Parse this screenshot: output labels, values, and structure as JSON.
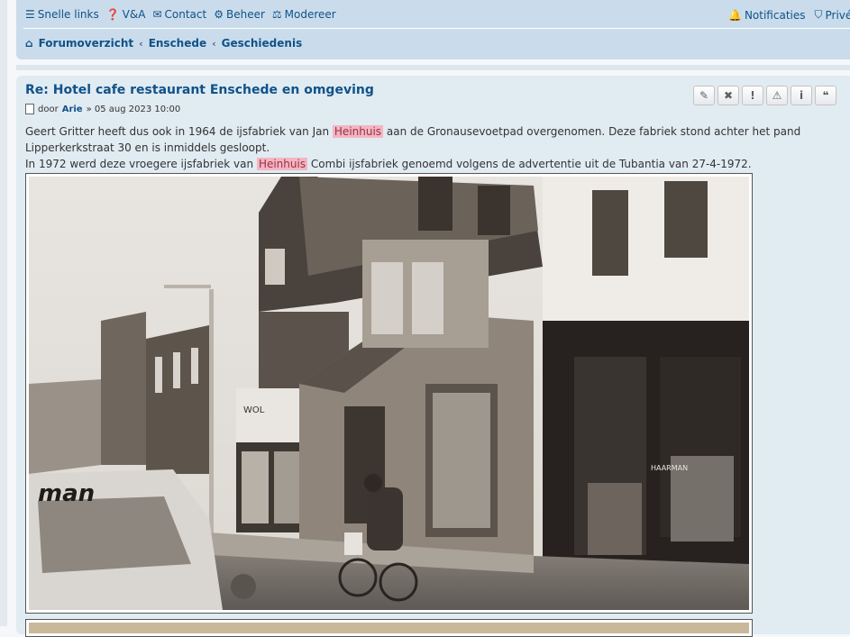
{
  "nav": {
    "quick_links": "Snelle links",
    "faq": "V&A",
    "contact": "Contact",
    "admin": "Beheer",
    "moderate": "Modereer",
    "notifications": "Notificaties",
    "private": "Privéb"
  },
  "breadcrumbs": [
    "Forumoverzicht",
    "Enschede",
    "Geschiedenis"
  ],
  "post": {
    "title": "Re: Hotel cafe restaurant Enschede en omgeving",
    "by": "door",
    "author": "Arie",
    "date": "» 05 aug 2023 10:00",
    "line1_a": "Geert Gritter heeft dus ook in 1964 de ijsfabriek van Jan ",
    "highlight": "Heinhuis",
    "line1_b": " aan de Gronausevoetpad overgenomen. Deze fabriek stond achter het pand",
    "line2": "Lipperkerkstraat 30 en is inmiddels gesloopt.",
    "line3_a": "In 1972 werd deze vroegere ijsfabriek van ",
    "line3_b": " Combi ijsfabriek genoemd volgens de advertentie uit de Tubantia van 27-4-1972.",
    "buttons": [
      "edit-icon",
      "delete-icon",
      "report-icon",
      "warn-icon",
      "info-icon",
      "quote-icon"
    ]
  },
  "photo": {
    "shop_sign": "HAARMAN",
    "van_text": "man",
    "store_text": "WOL"
  }
}
